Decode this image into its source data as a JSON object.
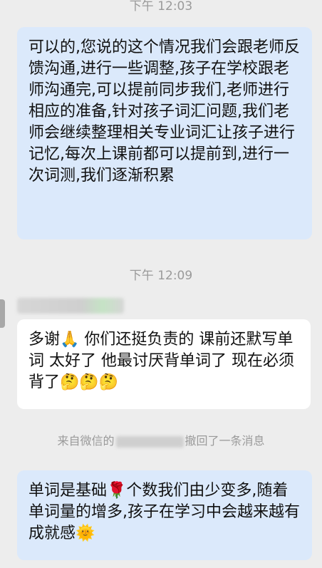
{
  "timestamps": [
    "下午 12:03",
    "下午 12:09"
  ],
  "messages": {
    "m1": "可以的,您说的这个情况我们会跟老师反馈沟通,进行一些调整,孩子在学校跟老师沟通完,可以提前同步我们,老师进行相应的准备,针对孩子词汇问题,我们老师会继续整理相关专业词汇让孩子进行记忆,每次上课前都可以提前到,进行一次词测,我们逐渐积累",
    "m2": "多谢🙏 你们还挺负责的 课前还默写单词 太好了 他最讨厌背单词了 现在必须背了🤔🤔🤔",
    "m3": "单词是基础🌹个数我们由少变多,随着单词量的增多,孩子在学习中会越来越有成就感🌞"
  },
  "notice": {
    "prefix": "来自微信的",
    "suffix": "撤回了一条消息"
  }
}
